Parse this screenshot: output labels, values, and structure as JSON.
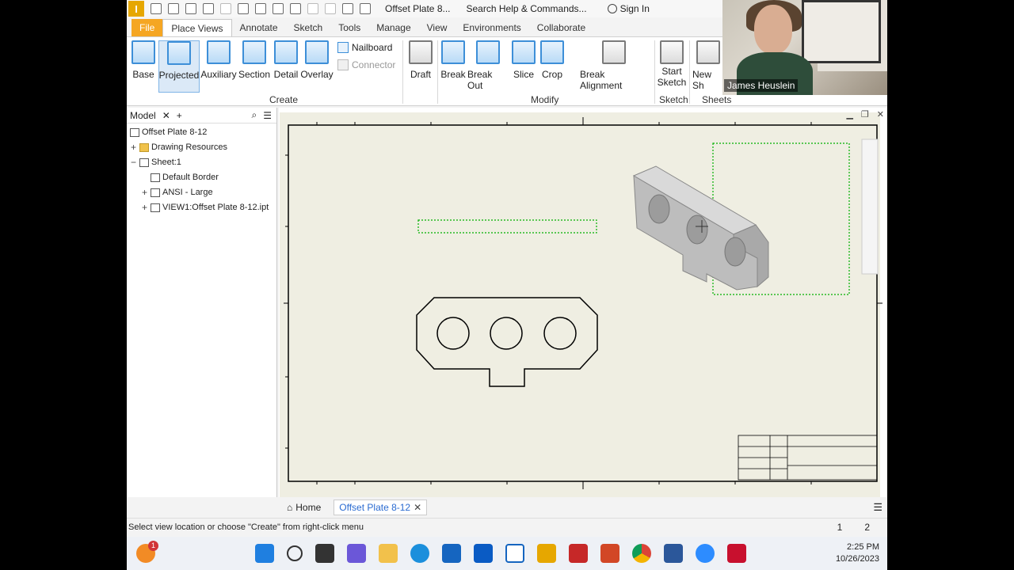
{
  "app": {
    "logo_letter": "I",
    "doc_title": "Offset Plate 8...",
    "search_placeholder": "Search Help & Commands...",
    "signin": "Sign In"
  },
  "tabs": [
    "File",
    "Place Views",
    "Annotate",
    "Sketch",
    "Tools",
    "Manage",
    "View",
    "Environments",
    "Collaborate"
  ],
  "active_tab": "Place Views",
  "ribbon": {
    "create": {
      "label": "Create",
      "buttons": [
        "Base",
        "Projected",
        "Auxiliary",
        "Section",
        "Detail",
        "Overlay"
      ],
      "small": [
        "Nailboard",
        "Connector"
      ]
    },
    "modify": {
      "label": "Modify",
      "buttons": [
        "Draft",
        "Break",
        "Break Out",
        "Slice",
        "Crop",
        "Break Alignment"
      ]
    },
    "sketch": {
      "label": "Sketch",
      "button_line1": "Start",
      "button_line2": "Sketch"
    },
    "sheets": {
      "label": "Sheets",
      "button": "New Sh"
    }
  },
  "browser": {
    "title": "Model",
    "tree": [
      {
        "label": "Offset Plate 8-12",
        "level": 0,
        "expander": ""
      },
      {
        "label": "Drawing Resources",
        "level": 1,
        "expander": "+"
      },
      {
        "label": "Sheet:1",
        "level": 1,
        "expander": "−"
      },
      {
        "label": "Default Border",
        "level": 2,
        "expander": ""
      },
      {
        "label": "ANSI - Large",
        "level": 2,
        "expander": "+"
      },
      {
        "label": "VIEW1:Offset Plate 8-12.ipt",
        "level": 2,
        "expander": "+"
      }
    ]
  },
  "doc_tabs": {
    "home": "Home",
    "active": "Offset Plate 8-12"
  },
  "status": {
    "message": "Select view location or choose \"Create\" from right-click menu",
    "page1": "1",
    "page2": "2"
  },
  "webcam": {
    "name": "James Heuslein"
  },
  "taskbar": {
    "time": "2:25 PM",
    "date": "10/26/2023",
    "badge": "1"
  },
  "colors": {
    "file_tab": "#f5a623",
    "selection": "#00b000",
    "sheet": "#efeee2"
  }
}
